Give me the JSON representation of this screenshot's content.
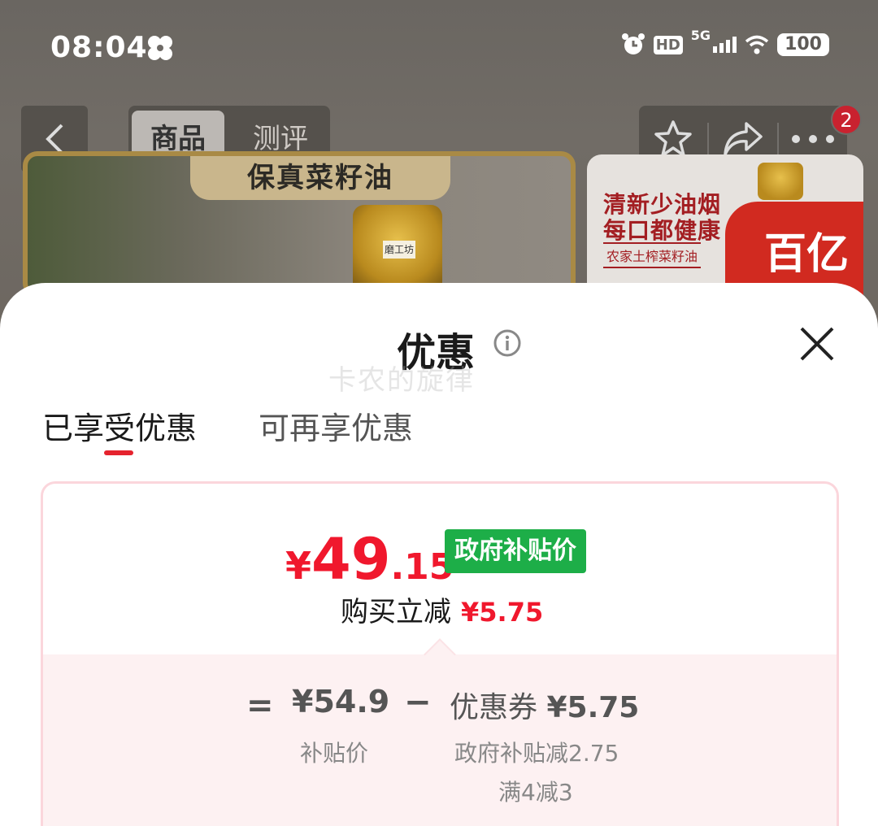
{
  "status_bar": {
    "time": "08:04",
    "hd": "HD",
    "network": "5G",
    "battery": "100"
  },
  "nav": {
    "tab_goods": "商品",
    "tab_review": "测评",
    "cart_badge": "2"
  },
  "product": {
    "left_title": "保真菜籽油",
    "bottle_brand": "磨工坊",
    "right_line1": "清新少油烟",
    "right_line2": "每口都健康",
    "right_line3": "农家土榨菜籽油",
    "right_promo": "百亿"
  },
  "sheet": {
    "title": "优惠",
    "watermark": "卡农的旋律",
    "tabs": [
      {
        "label": "已享受优惠",
        "active": true
      },
      {
        "label": "可再享优惠",
        "active": false
      }
    ],
    "price": {
      "currency": "¥",
      "integer": "49",
      "decimal": ".15",
      "tag": "政府补贴价"
    },
    "reduce_label": "购买立减",
    "reduce_amount": "¥5.75",
    "breakdown": {
      "equals": "=",
      "base_price": "¥54.9",
      "base_label": "补贴价",
      "minus": "−",
      "coupon_label": "优惠券",
      "coupon_amount": "¥5.75",
      "detail_1": "政府补贴减2.75",
      "detail_2": "满4减3"
    }
  },
  "colors": {
    "accent_red": "#f0182d",
    "gov_green": "#1dae48",
    "card_border": "#fbd6dc"
  }
}
